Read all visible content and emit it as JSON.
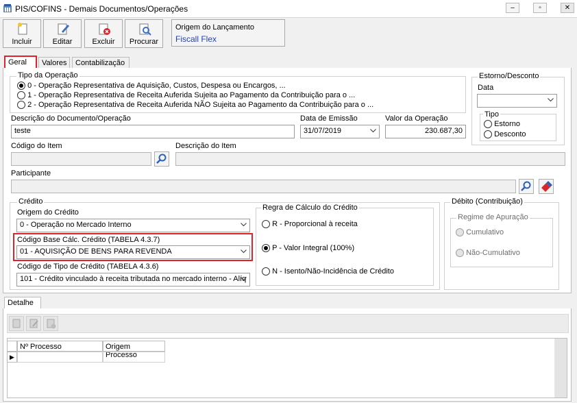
{
  "window": {
    "title": "PIS/COFINS - Demais Documentos/Operações"
  },
  "toolbar": {
    "incluir": "Incluir",
    "editar": "Editar",
    "excluir": "Excluir",
    "procurar": "Procurar"
  },
  "origem": {
    "label": "Origem do Lançamento",
    "value": "Fiscall Flex"
  },
  "tabs": [
    "Geral",
    "Valores",
    "Contabilização"
  ],
  "tipo_operacao": {
    "label": "Tipo da Operação",
    "options": [
      "0 - Operação Representativa de Aquisição, Custos, Despesa ou Encargos, ...",
      "1 - Operação Representativa de Receita Auferida Sujeita ao Pagamento da Contribuição para o ...",
      "2 - Operação Representativa de Receita Auferida NÃO Sujeita ao Pagamento da Contribuição para o ..."
    ],
    "selected_index": 0
  },
  "estorno": {
    "label": "Estorno/Desconto",
    "data_label": "Data",
    "data_value": "",
    "tipo_label": "Tipo",
    "tipo_options": [
      "Estorno",
      "Desconto"
    ]
  },
  "descricao": {
    "label": "Descrição do Documento/Operação",
    "value": "teste"
  },
  "data_emissao": {
    "label": "Data de Emissão",
    "value": "31/07/2019"
  },
  "valor": {
    "label": "Valor da Operação",
    "value": "230.687,30"
  },
  "codigo_item": {
    "label": "Código do Item",
    "value": ""
  },
  "descricao_item": {
    "label": "Descrição do Item",
    "value": ""
  },
  "participante": {
    "label": "Participante",
    "value": ""
  },
  "credito": {
    "label": "Crédito",
    "origem_label": "Origem do Crédito",
    "origem_value": "0 - Operação no Mercado Interno",
    "base_label": "Código Base Cálc. Crédito (TABELA 4.3.7)",
    "base_value": "01 - AQUISIÇÃO DE BENS PARA REVENDA",
    "tipo_label": "Código de Tipo de Crédito (TABELA 4.3.6)",
    "tipo_value": "101 - Crédito vinculado à receita tributada no mercado interno - Alíq",
    "regra_label": "Regra de Cálculo do Crédito",
    "regra_options": [
      "R - Proporcional à receita",
      "P - Valor Integral (100%)",
      "N - Isento/Não-Incidência de Crédito"
    ],
    "regra_selected": 1
  },
  "debito": {
    "label": "Débito (Contribuição)",
    "regime_label": "Regime de Apuração",
    "regime_options": [
      "Cumulativo",
      "Não-Cumulativo"
    ]
  },
  "detalhe": {
    "tab": "Detalhe",
    "columns": [
      "Nº Processo",
      "Origem Processo"
    ]
  },
  "colors": {
    "highlight": "#e0202a",
    "origin_value": "#1f3fbf"
  }
}
